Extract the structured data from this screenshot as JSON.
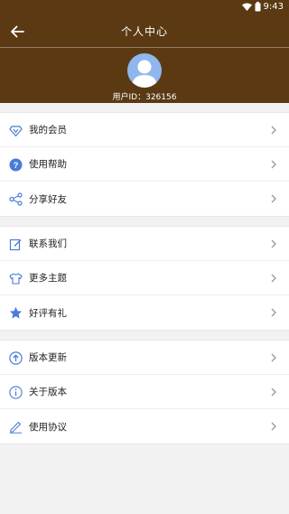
{
  "status_bar": {
    "time": "9:43",
    "icons": [
      "wifi-icon",
      "battery-icon"
    ]
  },
  "app_bar": {
    "title": "个人中心",
    "back_icon": "back-arrow-icon"
  },
  "profile": {
    "user_id_text": "用户ID：326156",
    "avatar_icon": "avatar-icon"
  },
  "menu_groups": [
    {
      "items": [
        {
          "label": "我的会员",
          "icon": "diamond-icon"
        },
        {
          "label": "使用帮助",
          "icon": "help-circle-icon"
        },
        {
          "label": "分享好友",
          "icon": "share-icon"
        }
      ]
    },
    {
      "items": [
        {
          "label": "联系我们",
          "icon": "edit-icon"
        },
        {
          "label": "更多主题",
          "icon": "shirt-icon"
        },
        {
          "label": "好评有礼",
          "icon": "star-icon"
        }
      ]
    },
    {
      "items": [
        {
          "label": "版本更新",
          "icon": "upload-circle-icon"
        },
        {
          "label": "关于版本",
          "icon": "info-circle-icon"
        },
        {
          "label": "使用协议",
          "icon": "pencil-icon"
        }
      ]
    }
  ],
  "colors": {
    "header": "#5b3a13",
    "icon_blue": "#4a7bd8",
    "icon_light": "#7aa2e6",
    "background": "#f2f2f2"
  }
}
